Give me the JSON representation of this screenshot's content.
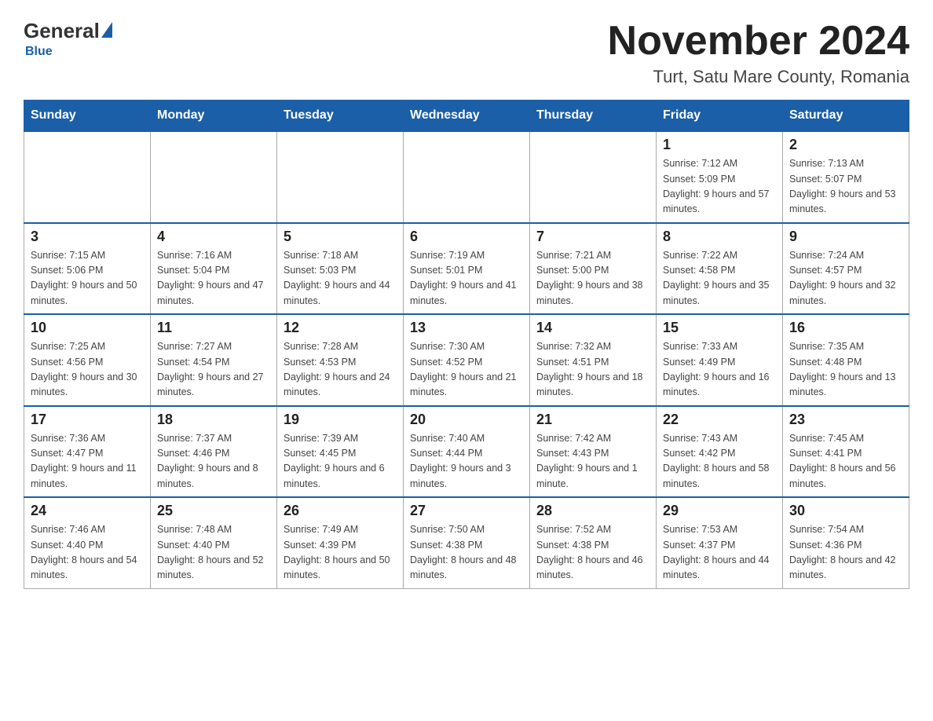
{
  "header": {
    "logo": {
      "general": "General",
      "blue": "Blue",
      "subtitle": "Blue"
    },
    "month_title": "November 2024",
    "location": "Turt, Satu Mare County, Romania"
  },
  "calendar": {
    "days_of_week": [
      "Sunday",
      "Monday",
      "Tuesday",
      "Wednesday",
      "Thursday",
      "Friday",
      "Saturday"
    ],
    "weeks": [
      [
        {
          "day": "",
          "info": ""
        },
        {
          "day": "",
          "info": ""
        },
        {
          "day": "",
          "info": ""
        },
        {
          "day": "",
          "info": ""
        },
        {
          "day": "",
          "info": ""
        },
        {
          "day": "1",
          "info": "Sunrise: 7:12 AM\nSunset: 5:09 PM\nDaylight: 9 hours and 57 minutes."
        },
        {
          "day": "2",
          "info": "Sunrise: 7:13 AM\nSunset: 5:07 PM\nDaylight: 9 hours and 53 minutes."
        }
      ],
      [
        {
          "day": "3",
          "info": "Sunrise: 7:15 AM\nSunset: 5:06 PM\nDaylight: 9 hours and 50 minutes."
        },
        {
          "day": "4",
          "info": "Sunrise: 7:16 AM\nSunset: 5:04 PM\nDaylight: 9 hours and 47 minutes."
        },
        {
          "day": "5",
          "info": "Sunrise: 7:18 AM\nSunset: 5:03 PM\nDaylight: 9 hours and 44 minutes."
        },
        {
          "day": "6",
          "info": "Sunrise: 7:19 AM\nSunset: 5:01 PM\nDaylight: 9 hours and 41 minutes."
        },
        {
          "day": "7",
          "info": "Sunrise: 7:21 AM\nSunset: 5:00 PM\nDaylight: 9 hours and 38 minutes."
        },
        {
          "day": "8",
          "info": "Sunrise: 7:22 AM\nSunset: 4:58 PM\nDaylight: 9 hours and 35 minutes."
        },
        {
          "day": "9",
          "info": "Sunrise: 7:24 AM\nSunset: 4:57 PM\nDaylight: 9 hours and 32 minutes."
        }
      ],
      [
        {
          "day": "10",
          "info": "Sunrise: 7:25 AM\nSunset: 4:56 PM\nDaylight: 9 hours and 30 minutes."
        },
        {
          "day": "11",
          "info": "Sunrise: 7:27 AM\nSunset: 4:54 PM\nDaylight: 9 hours and 27 minutes."
        },
        {
          "day": "12",
          "info": "Sunrise: 7:28 AM\nSunset: 4:53 PM\nDaylight: 9 hours and 24 minutes."
        },
        {
          "day": "13",
          "info": "Sunrise: 7:30 AM\nSunset: 4:52 PM\nDaylight: 9 hours and 21 minutes."
        },
        {
          "day": "14",
          "info": "Sunrise: 7:32 AM\nSunset: 4:51 PM\nDaylight: 9 hours and 18 minutes."
        },
        {
          "day": "15",
          "info": "Sunrise: 7:33 AM\nSunset: 4:49 PM\nDaylight: 9 hours and 16 minutes."
        },
        {
          "day": "16",
          "info": "Sunrise: 7:35 AM\nSunset: 4:48 PM\nDaylight: 9 hours and 13 minutes."
        }
      ],
      [
        {
          "day": "17",
          "info": "Sunrise: 7:36 AM\nSunset: 4:47 PM\nDaylight: 9 hours and 11 minutes."
        },
        {
          "day": "18",
          "info": "Sunrise: 7:37 AM\nSunset: 4:46 PM\nDaylight: 9 hours and 8 minutes."
        },
        {
          "day": "19",
          "info": "Sunrise: 7:39 AM\nSunset: 4:45 PM\nDaylight: 9 hours and 6 minutes."
        },
        {
          "day": "20",
          "info": "Sunrise: 7:40 AM\nSunset: 4:44 PM\nDaylight: 9 hours and 3 minutes."
        },
        {
          "day": "21",
          "info": "Sunrise: 7:42 AM\nSunset: 4:43 PM\nDaylight: 9 hours and 1 minute."
        },
        {
          "day": "22",
          "info": "Sunrise: 7:43 AM\nSunset: 4:42 PM\nDaylight: 8 hours and 58 minutes."
        },
        {
          "day": "23",
          "info": "Sunrise: 7:45 AM\nSunset: 4:41 PM\nDaylight: 8 hours and 56 minutes."
        }
      ],
      [
        {
          "day": "24",
          "info": "Sunrise: 7:46 AM\nSunset: 4:40 PM\nDaylight: 8 hours and 54 minutes."
        },
        {
          "day": "25",
          "info": "Sunrise: 7:48 AM\nSunset: 4:40 PM\nDaylight: 8 hours and 52 minutes."
        },
        {
          "day": "26",
          "info": "Sunrise: 7:49 AM\nSunset: 4:39 PM\nDaylight: 8 hours and 50 minutes."
        },
        {
          "day": "27",
          "info": "Sunrise: 7:50 AM\nSunset: 4:38 PM\nDaylight: 8 hours and 48 minutes."
        },
        {
          "day": "28",
          "info": "Sunrise: 7:52 AM\nSunset: 4:38 PM\nDaylight: 8 hours and 46 minutes."
        },
        {
          "day": "29",
          "info": "Sunrise: 7:53 AM\nSunset: 4:37 PM\nDaylight: 8 hours and 44 minutes."
        },
        {
          "day": "30",
          "info": "Sunrise: 7:54 AM\nSunset: 4:36 PM\nDaylight: 8 hours and 42 minutes."
        }
      ]
    ]
  }
}
